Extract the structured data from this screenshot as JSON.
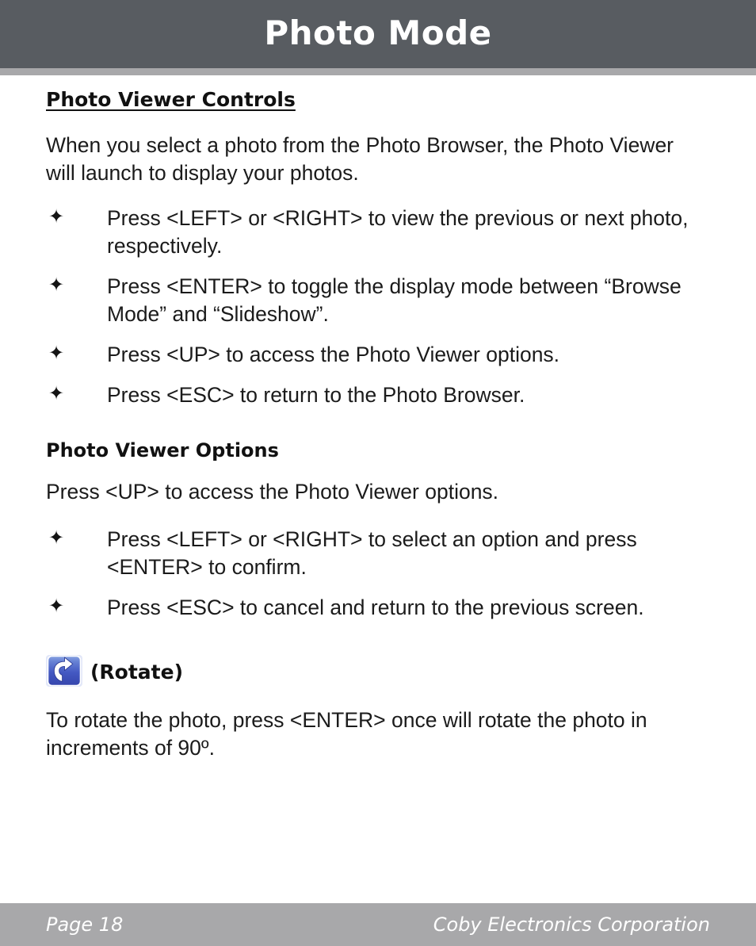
{
  "header": {
    "title": "Photo Mode",
    "bar_color": "#585c61",
    "rule_color": "#a8a8aa",
    "title_color": "#ffffff"
  },
  "sections": [
    {
      "heading": "Photo Viewer Controls",
      "underlined": true,
      "paragraph": "When you select a photo from the Photo Browser, the Photo Viewer will launch to display your photos.",
      "bullets": [
        "Press <LEFT> or <RIGHT> to view the previous or next photo, respectively.",
        "Press <ENTER> to toggle the display mode between “Browse Mode” and “Slideshow”.",
        "Press <UP> to access the Photo Viewer options.",
        "Press <ESC> to return to the Photo Browser."
      ]
    },
    {
      "heading": "Photo Viewer Options",
      "underlined": false,
      "paragraph": "Press <UP> to access the Photo Viewer options.",
      "bullets": [
        "Press <LEFT> or <RIGHT> to select an option and press <ENTER> to confirm.",
        "Press <ESC> to cancel and return to the previous screen."
      ]
    }
  ],
  "bullet_glyph": "✦",
  "rotate_block": {
    "icon_name": "rotate-clockwise-icon",
    "icon_colors": {
      "blue_top": "#7f9bdd",
      "blue_mid": "#4a63c4",
      "blue_bottom": "#3b4fb0",
      "arrow": "#ffffff",
      "halo": "#dfe4f7"
    },
    "label": "(Rotate)",
    "paragraph": "To rotate the photo, press <ENTER> once will rotate the photo in increments of 90º."
  },
  "footer": {
    "page_label": "Page 18",
    "company": "Coby Electronics Corporation",
    "bar_color": "#a8a8aa",
    "text_color": "#ffffff"
  }
}
